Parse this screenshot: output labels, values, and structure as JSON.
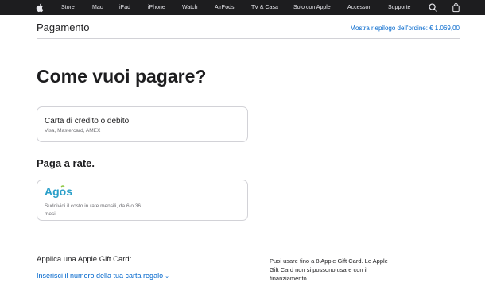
{
  "nav": {
    "apple_logo_icon": "apple-logo-icon",
    "items": [
      {
        "label": "Store"
      },
      {
        "label": "Mac"
      },
      {
        "label": "iPad"
      },
      {
        "label": "iPhone"
      },
      {
        "label": "Watch"
      },
      {
        "label": "AirPods"
      },
      {
        "label": "TV & Casa"
      },
      {
        "label": "Solo con Apple"
      },
      {
        "label": "Accessori"
      },
      {
        "label": "Supporte"
      }
    ],
    "search_icon": "search-icon",
    "bag_icon": "shopping-bag-icon"
  },
  "subheader": {
    "title": "Pagamento",
    "summary_link": "Mostra riepilogo dell'ordine: € 1.069,00"
  },
  "main": {
    "heading": "Come vuoi pagare?",
    "credit_card": {
      "title": "Carta di credito o debito",
      "subtitle": "Visa, Mastercard, AMEX"
    },
    "installments": {
      "heading": "Paga a rate.",
      "brand": "Agos",
      "description": "Suddividi il costo in rate mensili, da 6 o 36 mesi"
    },
    "gift_card": {
      "label": "Applica una Apple Gift Card:",
      "link": "Inserisci il numero della tua carta regalo",
      "info": "Puoi usare fino a 8 Apple Gift Card. Le Apple Gift Card non si possono usare con il finanziamento."
    }
  },
  "colors": {
    "nav_bg": "#1d1d1f",
    "link": "#0066cc",
    "agos_brand": "#2a9fc9"
  }
}
